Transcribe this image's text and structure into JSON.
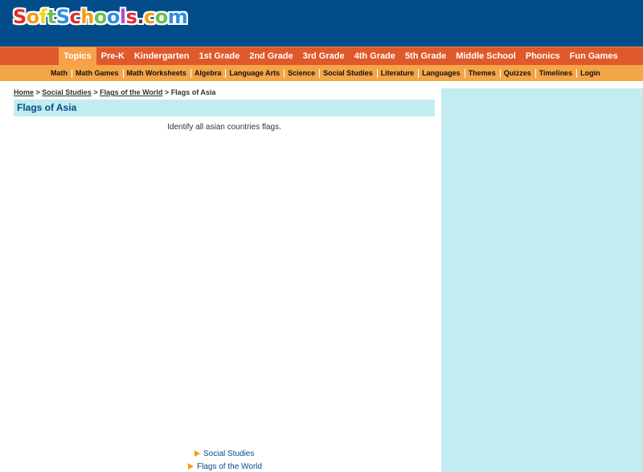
{
  "logo": {
    "letters": [
      "S",
      "o",
      "f",
      "t",
      "S",
      "c",
      "h",
      "o",
      "o",
      "l",
      "s",
      ".",
      "c",
      "o",
      "m"
    ],
    "colors": [
      "#e32d2d",
      "#f59b12",
      "#f7d21a",
      "#6cc04a",
      "#2d8fe3",
      "#e32d2d",
      "#f59b12",
      "#6cc04a",
      "#2d8fe3",
      "#b04ae3",
      "#e32d2d",
      "#444444",
      "#f59b12",
      "#6cc04a",
      "#2d8fe3"
    ]
  },
  "nav_primary": [
    "Topics",
    "Pre-K",
    "Kindergarten",
    "1st Grade",
    "2nd Grade",
    "3rd Grade",
    "4th Grade",
    "5th Grade",
    "Middle School",
    "Phonics",
    "Fun Games"
  ],
  "nav_secondary": [
    "Math",
    "Math Games",
    "Math Worksheets",
    "Algebra",
    "Language Arts",
    "Science",
    "Social Studies",
    "Literature",
    "Languages",
    "Themes",
    "Quizzes",
    "Timelines",
    "Login"
  ],
  "breadcrumb": {
    "home": "Home",
    "sep1": " > ",
    "social": "Social Studies",
    "sep2": " > ",
    "flags_world": "Flags of the World",
    "sep3": " > ",
    "current": "Flags of Asia"
  },
  "page": {
    "title": "Flags of Asia",
    "description": "Identify all asian countries flags."
  },
  "related": [
    "Social Studies",
    "Flags of the World"
  ],
  "colors": {
    "header": "#034c8a",
    "nav_primary": "#e0592a",
    "nav_active": "#f7a04a",
    "nav_secondary": "#f4a548",
    "panel": "#c2edf0"
  }
}
